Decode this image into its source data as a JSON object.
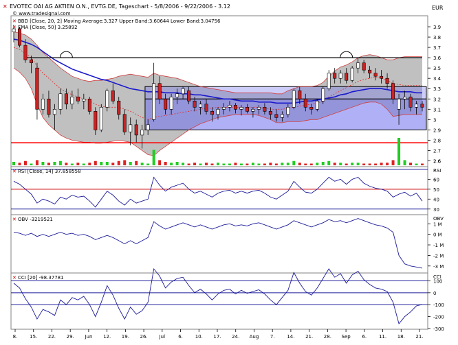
{
  "header": {
    "title": "EVOTEC OAI AG AKTIEN O.N., EVTG.DE, Tageschart - 5/8/2006 - 9/22/2006 - 3.12",
    "source": "© www.tradesignal.com",
    "currency": "EUR"
  },
  "legends": {
    "bbd": "BBD [Close, 20, 2] Moving Average:3.327 Upper Band:3.60644 Lower Band:3.04756",
    "ema": "EMA [Close, 50] 3.25892",
    "rsi": "RSI [Close, 14] 37.858558",
    "obv": "OBV -3219521",
    "cci": "CCI [20] -98.37781"
  },
  "pane_labels": {
    "rsi": "RSI",
    "obv": "OBV",
    "cci": "CCI"
  },
  "colors": {
    "band_fill": "#c0c0c0",
    "band_edge": "#d04040",
    "ma": "#e03030",
    "ema": "#1a1acc",
    "rect": "#7070ee",
    "resistance": "#000000",
    "support": "#ff0000",
    "vol_up": "#22cc22",
    "vol_down": "#dd2222",
    "indicator": "#1a1a99",
    "candle_up": "#ffffff",
    "candle_down": "#cc2222"
  },
  "chart_data": [
    {
      "type": "candlestick",
      "pane": "price",
      "xlabel_ticks": [
        "8.",
        "15.",
        "22.",
        "29.",
        "Jun",
        "12.",
        "19.",
        "26.",
        "Jul",
        "6.",
        "10.",
        "17.",
        "24.",
        "Aug",
        "7.",
        "14.",
        "21.",
        "28.",
        "Sep",
        "6.",
        "11.",
        "18.",
        "21."
      ],
      "ylim": [
        2.55,
        4.0
      ],
      "yticks": [
        2.6,
        2.7,
        2.8,
        2.9,
        3,
        3.1,
        3.2,
        3.3,
        3.4,
        3.5,
        3.6,
        3.7,
        3.8,
        3.9
      ],
      "candles_ohlc": [
        [
          3.85,
          3.92,
          3.75,
          3.88
        ],
        [
          3.88,
          3.9,
          3.7,
          3.72
        ],
        [
          3.72,
          3.78,
          3.55,
          3.58
        ],
        [
          3.58,
          3.62,
          3.45,
          3.55
        ],
        [
          3.5,
          3.55,
          3.0,
          3.1
        ],
        [
          3.1,
          3.25,
          3.05,
          3.2
        ],
        [
          3.2,
          3.28,
          3.02,
          3.05
        ],
        [
          3.05,
          3.15,
          2.9,
          3.1
        ],
        [
          3.1,
          3.3,
          3.05,
          3.25
        ],
        [
          3.25,
          3.3,
          3.1,
          3.15
        ],
        [
          3.15,
          3.28,
          3.1,
          3.22
        ],
        [
          3.22,
          3.3,
          3.15,
          3.18
        ],
        [
          3.18,
          3.25,
          3.1,
          3.2
        ],
        [
          3.2,
          3.22,
          3.05,
          3.08
        ],
        [
          3.08,
          3.12,
          2.85,
          2.9
        ],
        [
          2.9,
          3.15,
          2.88,
          3.12
        ],
        [
          3.12,
          3.3,
          3.08,
          3.28
        ],
        [
          3.28,
          3.35,
          3.15,
          3.18
        ],
        [
          3.18,
          3.22,
          3.0,
          3.05
        ],
        [
          3.05,
          3.1,
          2.85,
          2.88
        ],
        [
          2.88,
          3.02,
          2.75,
          2.95
        ],
        [
          2.95,
          3.0,
          2.78,
          2.85
        ],
        [
          2.85,
          2.95,
          2.72,
          2.9
        ],
        [
          2.9,
          3.0,
          2.85,
          2.95
        ],
        [
          3.0,
          3.55,
          2.98,
          3.35
        ],
        [
          3.35,
          3.42,
          3.15,
          3.2
        ],
        [
          3.2,
          3.25,
          3.05,
          3.1
        ],
        [
          3.1,
          3.25,
          3.05,
          3.22
        ],
        [
          3.22,
          3.3,
          3.15,
          3.25
        ],
        [
          3.25,
          3.32,
          3.2,
          3.3
        ],
        [
          3.28,
          3.32,
          3.15,
          3.18
        ],
        [
          3.18,
          3.22,
          3.08,
          3.12
        ],
        [
          3.12,
          3.18,
          3.05,
          3.15
        ],
        [
          3.15,
          3.2,
          3.05,
          3.08
        ],
        [
          3.08,
          3.12,
          2.98,
          3.05
        ],
        [
          3.05,
          3.12,
          3.0,
          3.1
        ],
        [
          3.1,
          3.16,
          3.05,
          3.12
        ],
        [
          3.12,
          3.18,
          3.08,
          3.14
        ],
        [
          3.14,
          3.16,
          3.06,
          3.1
        ],
        [
          3.1,
          3.14,
          3.04,
          3.12
        ],
        [
          3.12,
          3.15,
          3.06,
          3.08
        ],
        [
          3.08,
          3.12,
          3.02,
          3.1
        ],
        [
          3.1,
          3.14,
          3.05,
          3.12
        ],
        [
          3.12,
          3.16,
          3.05,
          3.08
        ],
        [
          3.08,
          3.12,
          3.0,
          3.05
        ],
        [
          3.05,
          3.1,
          2.98,
          3.02
        ],
        [
          3.02,
          3.08,
          2.98,
          3.05
        ],
        [
          3.05,
          3.15,
          3.02,
          3.12
        ],
        [
          3.12,
          3.3,
          3.1,
          3.28
        ],
        [
          3.28,
          3.32,
          3.15,
          3.2
        ],
        [
          3.2,
          3.25,
          3.08,
          3.12
        ],
        [
          3.12,
          3.15,
          3.05,
          3.1
        ],
        [
          3.1,
          3.2,
          3.08,
          3.18
        ],
        [
          3.18,
          3.32,
          3.15,
          3.3
        ],
        [
          3.3,
          3.48,
          3.28,
          3.45
        ],
        [
          3.45,
          3.5,
          3.35,
          3.4
        ],
        [
          3.4,
          3.48,
          3.35,
          3.45
        ],
        [
          3.45,
          3.5,
          3.35,
          3.38
        ],
        [
          3.38,
          3.52,
          3.36,
          3.5
        ],
        [
          3.5,
          3.6,
          3.45,
          3.55
        ],
        [
          3.55,
          3.58,
          3.45,
          3.48
        ],
        [
          3.48,
          3.52,
          3.4,
          3.45
        ],
        [
          3.45,
          3.5,
          3.38,
          3.42
        ],
        [
          3.42,
          3.48,
          3.35,
          3.4
        ],
        [
          3.4,
          3.45,
          3.3,
          3.35
        ],
        [
          3.35,
          3.38,
          3.15,
          3.2
        ],
        [
          3.1,
          3.25,
          2.95,
          3.2
        ],
        [
          3.2,
          3.28,
          3.1,
          3.22
        ],
        [
          3.22,
          3.25,
          3.08,
          3.12
        ],
        [
          3.12,
          3.18,
          3.05,
          3.15
        ],
        [
          3.15,
          3.18,
          3.08,
          3.12
        ]
      ],
      "bollinger": {
        "upper": [
          3.85,
          3.84,
          3.82,
          3.78,
          3.72,
          3.65,
          3.6,
          3.55,
          3.5,
          3.46,
          3.42,
          3.4,
          3.38,
          3.37,
          3.38,
          3.38,
          3.39,
          3.4,
          3.42,
          3.43,
          3.44,
          3.43,
          3.42,
          3.41,
          3.45,
          3.43,
          3.42,
          3.41,
          3.4,
          3.38,
          3.36,
          3.34,
          3.32,
          3.31,
          3.3,
          3.29,
          3.28,
          3.27,
          3.26,
          3.26,
          3.26,
          3.26,
          3.26,
          3.26,
          3.26,
          3.25,
          3.25,
          3.28,
          3.3,
          3.32,
          3.32,
          3.32,
          3.33,
          3.36,
          3.42,
          3.47,
          3.51,
          3.53,
          3.56,
          3.6,
          3.62,
          3.63,
          3.62,
          3.6,
          3.58,
          3.58,
          3.6,
          3.61,
          3.61,
          3.61,
          3.61
        ],
        "ma": [
          3.7,
          3.68,
          3.64,
          3.6,
          3.52,
          3.45,
          3.4,
          3.35,
          3.3,
          3.27,
          3.24,
          3.22,
          3.2,
          3.18,
          3.15,
          3.13,
          3.12,
          3.12,
          3.12,
          3.1,
          3.08,
          3.05,
          3.02,
          3.0,
          3.02,
          3.03,
          3.04,
          3.05,
          3.06,
          3.07,
          3.08,
          3.09,
          3.1,
          3.11,
          3.11,
          3.12,
          3.12,
          3.12,
          3.12,
          3.12,
          3.12,
          3.12,
          3.12,
          3.11,
          3.1,
          3.1,
          3.1,
          3.11,
          3.12,
          3.13,
          3.14,
          3.15,
          3.16,
          3.18,
          3.22,
          3.25,
          3.28,
          3.31,
          3.34,
          3.37,
          3.39,
          3.4,
          3.41,
          3.4,
          3.38,
          3.35,
          3.34,
          3.33,
          3.33,
          3.33,
          3.33
        ],
        "lower": [
          3.5,
          3.46,
          3.4,
          3.3,
          3.15,
          3.02,
          2.95,
          2.9,
          2.85,
          2.82,
          2.8,
          2.79,
          2.78,
          2.78,
          2.77,
          2.77,
          2.78,
          2.79,
          2.8,
          2.79,
          2.78,
          2.74,
          2.7,
          2.66,
          2.65,
          2.7,
          2.74,
          2.78,
          2.82,
          2.86,
          2.9,
          2.93,
          2.96,
          2.98,
          3.0,
          3.02,
          3.03,
          3.04,
          3.05,
          3.05,
          3.05,
          3.05,
          3.04,
          3.02,
          3.0,
          2.97,
          2.97,
          2.98,
          2.98,
          2.98,
          2.99,
          3.0,
          3.0,
          3.02,
          3.04,
          3.06,
          3.08,
          3.1,
          3.12,
          3.14,
          3.16,
          3.17,
          3.17,
          3.15,
          3.1,
          3.03,
          3.04,
          3.05,
          3.05,
          3.05,
          3.05
        ]
      },
      "ema50": [
        3.78,
        3.77,
        3.75,
        3.73,
        3.7,
        3.66,
        3.62,
        3.58,
        3.55,
        3.52,
        3.49,
        3.47,
        3.45,
        3.43,
        3.41,
        3.39,
        3.38,
        3.36,
        3.34,
        3.32,
        3.3,
        3.29,
        3.28,
        3.27,
        3.27,
        3.27,
        3.26,
        3.26,
        3.26,
        3.25,
        3.25,
        3.24,
        3.24,
        3.23,
        3.22,
        3.21,
        3.2,
        3.2,
        3.19,
        3.18,
        3.18,
        3.18,
        3.17,
        3.17,
        3.17,
        3.16,
        3.16,
        3.16,
        3.16,
        3.17,
        3.18,
        3.18,
        3.19,
        3.2,
        3.21,
        3.22,
        3.24,
        3.25,
        3.27,
        3.28,
        3.29,
        3.3,
        3.3,
        3.3,
        3.29,
        3.28,
        3.27,
        3.27,
        3.27,
        3.26,
        3.26
      ],
      "volume_up_down": [
        1,
        0,
        0,
        1,
        0,
        1,
        0,
        1,
        1,
        0,
        1,
        0,
        1,
        0,
        0,
        1,
        1,
        0,
        0,
        0,
        1,
        0,
        1,
        1,
        1,
        0,
        0,
        1,
        1,
        1,
        0,
        0,
        1,
        0,
        0,
        1,
        1,
        1,
        0,
        1,
        0,
        1,
        1,
        0,
        0,
        0,
        1,
        1,
        1,
        0,
        0,
        0,
        1,
        1,
        1,
        0,
        1,
        0,
        1,
        1,
        0,
        0,
        0,
        0,
        0,
        0,
        1,
        1,
        0,
        1,
        0
      ],
      "volume": [
        4,
        3,
        5,
        2,
        6,
        4,
        3,
        4,
        5,
        3,
        2,
        3,
        2,
        3,
        5,
        4,
        4,
        3,
        5,
        6,
        4,
        5,
        3,
        2,
        18,
        6,
        4,
        3,
        4,
        3,
        2,
        3,
        2,
        3,
        2,
        3,
        2,
        2,
        3,
        2,
        2,
        3,
        2,
        2,
        3,
        2,
        3,
        3,
        5,
        3,
        2,
        2,
        3,
        4,
        5,
        3,
        3,
        2,
        3,
        3,
        2,
        2,
        2,
        3,
        3,
        6,
        32,
        6,
        3,
        2,
        2
      ],
      "horizontal_lines": {
        "resistance": 3.6,
        "support": 2.775
      },
      "rectangles": [
        {
          "y_from": 2.9,
          "y_to": 3.2
        },
        {
          "y_from": 3.2,
          "y_to": 3.32
        }
      ]
    },
    {
      "type": "line",
      "pane": "rsi",
      "ylim": [
        25,
        72
      ],
      "yticks": [
        30,
        40,
        50,
        60
      ],
      "levels": [
        30,
        50,
        70
      ],
      "values": [
        58,
        55,
        50,
        45,
        36,
        40,
        38,
        35,
        42,
        40,
        44,
        42,
        43,
        38,
        32,
        40,
        48,
        44,
        38,
        34,
        40,
        36,
        38,
        40,
        62,
        54,
        48,
        52,
        54,
        56,
        50,
        46,
        48,
        45,
        42,
        46,
        48,
        49,
        46,
        48,
        46,
        48,
        49,
        46,
        42,
        40,
        44,
        48,
        58,
        52,
        47,
        46,
        50,
        56,
        62,
        58,
        60,
        55,
        60,
        62,
        56,
        53,
        51,
        50,
        48,
        42,
        45,
        47,
        43,
        46,
        38
      ]
    },
    {
      "type": "line",
      "pane": "obv",
      "ylim": [
        -3.6,
        1.8
      ],
      "yticks": [
        "1 M",
        "0 M",
        "-1 M",
        "-2 M",
        "-3 M"
      ],
      "values": [
        0.2,
        0.1,
        -0.1,
        0.1,
        -0.2,
        0.0,
        -0.2,
        0.0,
        0.2,
        0.0,
        0.1,
        -0.1,
        0.0,
        -0.2,
        -0.5,
        -0.3,
        -0.1,
        -0.3,
        -0.6,
        -0.9,
        -0.6,
        -0.9,
        -0.6,
        -0.3,
        1.2,
        0.8,
        0.5,
        0.7,
        0.9,
        1.1,
        0.9,
        0.7,
        0.9,
        0.7,
        0.5,
        0.7,
        0.9,
        1.0,
        0.8,
        0.9,
        0.8,
        1.0,
        1.1,
        0.9,
        0.7,
        0.5,
        0.7,
        0.9,
        1.3,
        1.1,
        0.9,
        0.7,
        0.9,
        1.1,
        1.4,
        1.2,
        1.3,
        1.1,
        1.3,
        1.5,
        1.3,
        1.1,
        0.9,
        0.8,
        0.6,
        0.2,
        -2.0,
        -2.8,
        -3.0,
        -3.1,
        -3.2
      ]
    },
    {
      "type": "line",
      "pane": "cci",
      "ylim": [
        -300,
        160
      ],
      "yticks": [
        "100",
        "0",
        "-100",
        "-200",
        "-300"
      ],
      "levels": [
        100,
        -100
      ],
      "values": [
        80,
        40,
        -50,
        -120,
        -220,
        -140,
        -160,
        -190,
        -60,
        -100,
        -40,
        -60,
        -30,
        -100,
        -200,
        -80,
        60,
        -20,
        -130,
        -220,
        -120,
        -180,
        -150,
        -80,
        200,
        140,
        40,
        90,
        120,
        130,
        60,
        0,
        30,
        -10,
        -60,
        -10,
        20,
        30,
        -10,
        20,
        -5,
        10,
        25,
        -10,
        -60,
        -100,
        -40,
        20,
        170,
        80,
        10,
        -20,
        40,
        120,
        200,
        130,
        160,
        80,
        150,
        180,
        110,
        70,
        40,
        30,
        10,
        -80,
        -260,
        -200,
        -160,
        -110,
        -98
      ]
    }
  ]
}
